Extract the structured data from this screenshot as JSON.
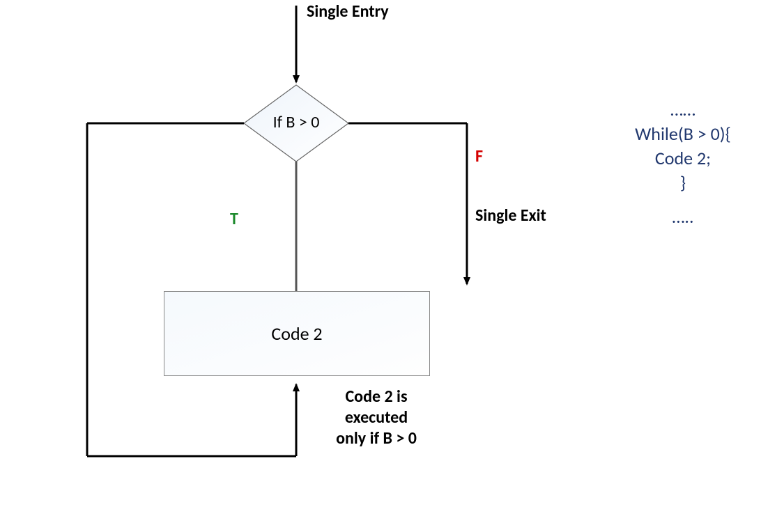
{
  "labels": {
    "entry": "Single Entry",
    "exit": "Single Exit",
    "cond": "If B > 0",
    "code_block": "Code 2",
    "true": "T",
    "false": "F",
    "annotation_l1": "Code 2 is",
    "annotation_l2": "executed",
    "annotation_l3": "only if B > 0"
  },
  "code": {
    "pre": "……",
    "l1": "While(B > 0){",
    "l2": "Code 2;",
    "l3": "}",
    "post": "….."
  },
  "chart_data": {
    "type": "flowchart",
    "nodes": [
      {
        "id": "entry",
        "kind": "entry",
        "label": "Single Entry"
      },
      {
        "id": "cond",
        "kind": "decision",
        "label": "If B > 0"
      },
      {
        "id": "code2",
        "kind": "process",
        "label": "Code 2"
      },
      {
        "id": "exit",
        "kind": "exit",
        "label": "Single Exit"
      }
    ],
    "edges": [
      {
        "from": "entry",
        "to": "cond"
      },
      {
        "from": "cond",
        "to": "code2",
        "label": "T"
      },
      {
        "from": "cond",
        "to": "exit",
        "label": "F"
      },
      {
        "from": "code2",
        "to": "cond",
        "kind": "loop-back"
      }
    ],
    "annotation": "Code 2 is executed only if B > 0",
    "pseudocode": [
      "……",
      "While(B > 0){",
      "  Code 2;",
      "}",
      "….."
    ]
  }
}
